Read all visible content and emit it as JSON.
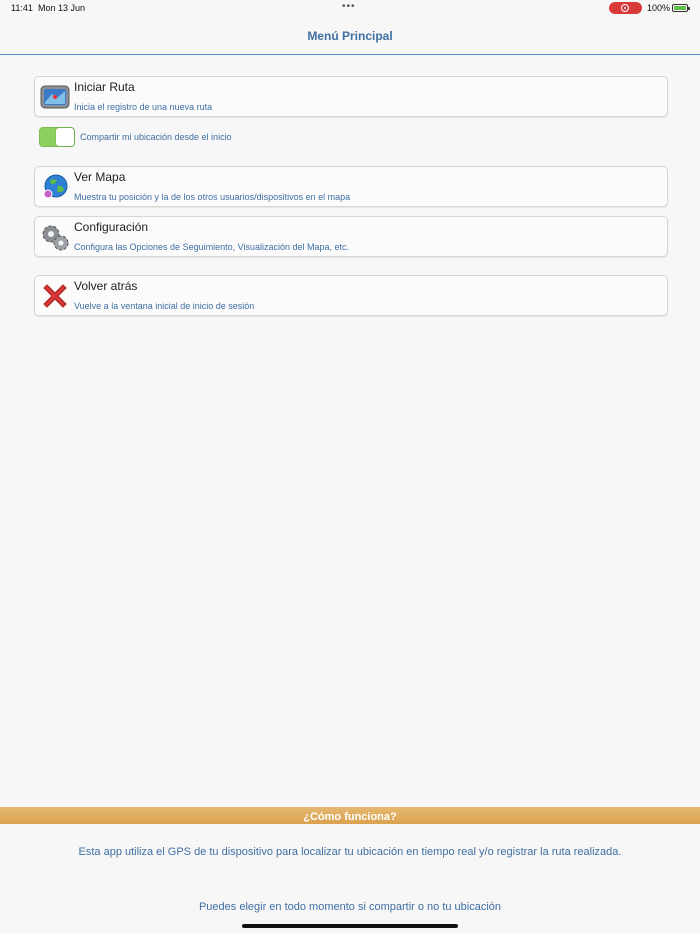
{
  "status_bar": {
    "time": "11:41",
    "date": "Mon 13 Jun",
    "dots": "•••",
    "battery": "100%"
  },
  "nav": {
    "title": "Menú Principal"
  },
  "menu": {
    "start_route": {
      "title": "Iniciar Ruta",
      "subtitle": "Inicia el registro de una nueva ruta",
      "icon": "gps-device-icon"
    },
    "share_toggle": {
      "label": "Compartir mi ubicación desde el inicio",
      "on": true
    },
    "view_map": {
      "title": "Ver Mapa",
      "subtitle": "Muestra tu posición y la de los otros usuarios/dispositivos en el mapa",
      "icon": "globe-icon"
    },
    "settings": {
      "title": "Configuración",
      "subtitle": "Configura las Opciones de Seguimiento, Visualización del Mapa, etc.",
      "icon": "gears-icon"
    },
    "go_back": {
      "title": "Volver atrás",
      "subtitle": "Vuelve a la ventana inicial de inicio de sesión",
      "icon": "red-x-icon"
    }
  },
  "info": {
    "title": "¿Cómo funciona?",
    "line1": "Esta app utiliza el GPS de tu dispositivo para localizar tu ubicación en tiempo real y/o registrar la ruta realizada.",
    "line2": "Puedes elegir en todo momento si compartir o no tu ubicación"
  },
  "colors": {
    "accent_blue": "#3f6fa3",
    "nav_divider": "#4f8ec9",
    "toggle_on": "#8cd05f",
    "info_bar": "#d9a24f",
    "rec_red": "#d93a3a"
  }
}
